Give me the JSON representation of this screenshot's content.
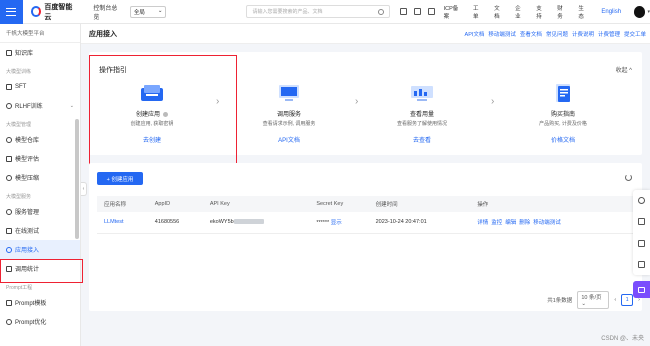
{
  "topbar": {
    "logo": "百度智能云",
    "console": "控制台总览",
    "region": "全局",
    "search_placeholder": "请输入您需要搜索的产品、文档",
    "links": [
      "ICP备案",
      "工单",
      "文档",
      "企业",
      "支持",
      "财务",
      "生态"
    ],
    "lang": "English"
  },
  "sidebar": {
    "title": "千帆大模型平台",
    "items": [
      {
        "type": "item",
        "label": "知识库",
        "icon": "book-icon"
      },
      {
        "type": "section",
        "label": "大模型训练"
      },
      {
        "type": "item",
        "label": "SFT",
        "icon": "gear-icon"
      },
      {
        "type": "item",
        "label": "RLHF训练",
        "icon": "gear-icon",
        "caret": "⌄"
      },
      {
        "type": "section",
        "label": "大模型管理"
      },
      {
        "type": "item",
        "label": "模型仓库",
        "icon": "cube-icon"
      },
      {
        "type": "item",
        "label": "模型评估",
        "icon": "chart-icon"
      },
      {
        "type": "item",
        "label": "模型压缩",
        "icon": "compress-icon"
      },
      {
        "type": "section",
        "label": "大模型服务"
      },
      {
        "type": "item",
        "label": "服务管理",
        "icon": "server-icon"
      },
      {
        "type": "item",
        "label": "在线测试",
        "icon": "test-icon"
      },
      {
        "type": "item",
        "label": "应用接入",
        "icon": "plug-icon",
        "active": true
      },
      {
        "type": "item",
        "label": "调用统计",
        "icon": "stats-icon"
      },
      {
        "type": "section",
        "label": "Prompt工程"
      },
      {
        "type": "item",
        "label": "Prompt模板",
        "icon": "template-icon"
      },
      {
        "type": "item",
        "label": "Prompt优化",
        "icon": "optimize-icon"
      }
    ]
  },
  "header": {
    "title": "应用接入",
    "links": [
      "API文档",
      "移动端测试",
      "查看文档",
      "常见问题",
      "计费说明",
      "计费管理",
      "提交工单"
    ]
  },
  "guide": {
    "title": "操作指引",
    "collapse": "收起 ^",
    "steps": [
      {
        "title": "创建应用",
        "desc": "创建应用, 获取密钥",
        "link": "去创建"
      },
      {
        "title": "调用服务",
        "desc": "查看请求示例, 调用服务",
        "link": "API文档"
      },
      {
        "title": "查看用量",
        "desc": "查看服务了解使用情况",
        "link": "去查看"
      },
      {
        "title": "购买指南",
        "desc": "产品购买, 计费及价格",
        "link": "价格文档"
      }
    ]
  },
  "table": {
    "create_label": "+ 创建应用",
    "columns": [
      "应用名称",
      "AppID",
      "API Key",
      "Secret Key",
      "创建时间",
      "操作"
    ],
    "rows": [
      {
        "name": "LLMtest",
        "appid": "41680556",
        "apikey": "ekoWY5b",
        "secret": "******",
        "show": "显示",
        "created": "2023-10-24 20:47:01",
        "ops": [
          "详情",
          "监控",
          "编辑",
          "删除",
          "移动端测试"
        ]
      }
    ]
  },
  "pager": {
    "total": "共1条数据",
    "page_size": "10 条/页",
    "current": "1"
  },
  "watermark": "CSDN @、未央"
}
